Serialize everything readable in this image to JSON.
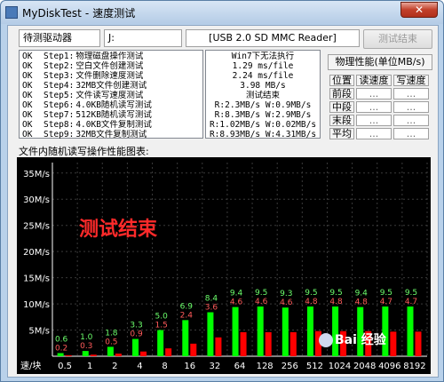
{
  "window": {
    "app_name": "MyDiskTest",
    "separator": "-",
    "title": "速度测试",
    "close_symbol": "✕"
  },
  "toolbar": {
    "drive_label": "待测驱动器",
    "drive_letter": "J:",
    "device_name": "[USB 2.0 SD MMC Reader]",
    "button_label": "测试结束"
  },
  "steps": [
    {
      "status": "OK",
      "step": "Step1:",
      "desc": "物理磁盘操作测试"
    },
    {
      "status": "OK",
      "step": "Step2:",
      "desc": "空白文件创建测试"
    },
    {
      "status": "OK",
      "step": "Step3:",
      "desc": "文件删除速度测试"
    },
    {
      "status": "OK",
      "step": "Step4:",
      "desc": "32MB文件创建测试"
    },
    {
      "status": "OK",
      "step": "Step5:",
      "desc": "文件读写速度测试"
    },
    {
      "status": "OK",
      "step": "Step6:",
      "desc": "4.0KB随机读写测试"
    },
    {
      "status": "OK",
      "step": "Step7:",
      "desc": "512KB随机读写测试"
    },
    {
      "status": "OK",
      "step": "Step8:",
      "desc": "4.0KB文件复制测试"
    },
    {
      "status": "OK",
      "step": "Step9:",
      "desc": "32MB文件复制测试"
    }
  ],
  "results": [
    "Win7下无法执行",
    "1.29 ms/file",
    "2.24 ms/file",
    "3.98 MB/s",
    "测试结束",
    "R:2.3MB/s W:0.9MB/s",
    "R:8.3MB/s W:2.9MB/s",
    "R:1.02MB/s W:0.02MB/s",
    "R:8.93MB/s W:4.31MB/s"
  ],
  "perf": {
    "title": "物理性能(单位MB/s)",
    "headers": [
      "位置",
      "读速度",
      "写速度"
    ],
    "rows": [
      {
        "label": "前段",
        "read": "...",
        "write": "..."
      },
      {
        "label": "中段",
        "read": "...",
        "write": "..."
      },
      {
        "label": "末段",
        "read": "...",
        "write": "..."
      },
      {
        "label": "平均",
        "read": "...",
        "write": "..."
      }
    ]
  },
  "chart_label": "文件内随机读写操作性能图表:",
  "watermark": "Bai 经验",
  "colors": {
    "read_bar": "#00ff00",
    "write_bar": "#ff0000",
    "read_label": "#6cff6c",
    "write_label": "#ff5a5a",
    "chart_bg": "#000000",
    "grid": "#3a3a3a",
    "overlay": "#ff2a2a"
  },
  "chart_data": {
    "type": "bar",
    "overlay_text": "测试结束",
    "x_title": "速/块",
    "categories": [
      "0.5",
      "1",
      "2",
      "4",
      "8",
      "16",
      "32",
      "64",
      "128",
      "256",
      "512",
      "1024",
      "2048",
      "4096",
      "8192"
    ],
    "series": [
      {
        "name": "read",
        "values": [
          0.6,
          1.0,
          1.8,
          3.3,
          5.0,
          6.9,
          8.4,
          9.4,
          9.5,
          9.3,
          9.5,
          9.5,
          9.4,
          9.5,
          9.5
        ],
        "labels": [
          "0.6",
          "1.0",
          "1.8",
          "3.3",
          "5.0",
          "6.9",
          "8.4",
          "9.4",
          "9.5",
          "9.3",
          "9.5",
          "9.5",
          "9.4",
          "9.5",
          "9.5"
        ]
      },
      {
        "name": "write",
        "values": [
          0.2,
          0.3,
          0.5,
          0.9,
          1.5,
          2.4,
          3.6,
          4.6,
          4.6,
          4.6,
          4.8,
          4.8,
          4.8,
          4.7,
          4.7
        ],
        "labels": [
          "0.2",
          "0.3",
          "0.5",
          "0.9",
          "1.5",
          "2.4",
          "3.6",
          "4.6",
          "4.6",
          "4.6",
          "4.8",
          "4.8",
          "4.8",
          "4.7",
          "4.7"
        ]
      }
    ],
    "y_ticks": [
      "35M/s",
      "30M/s",
      "25M/s",
      "20M/s",
      "15M/s",
      "10M/s",
      "5M/s"
    ],
    "y_tick_values": [
      35,
      30,
      25,
      20,
      15,
      10,
      5
    ],
    "ylim": [
      0,
      37
    ],
    "grid": true
  }
}
